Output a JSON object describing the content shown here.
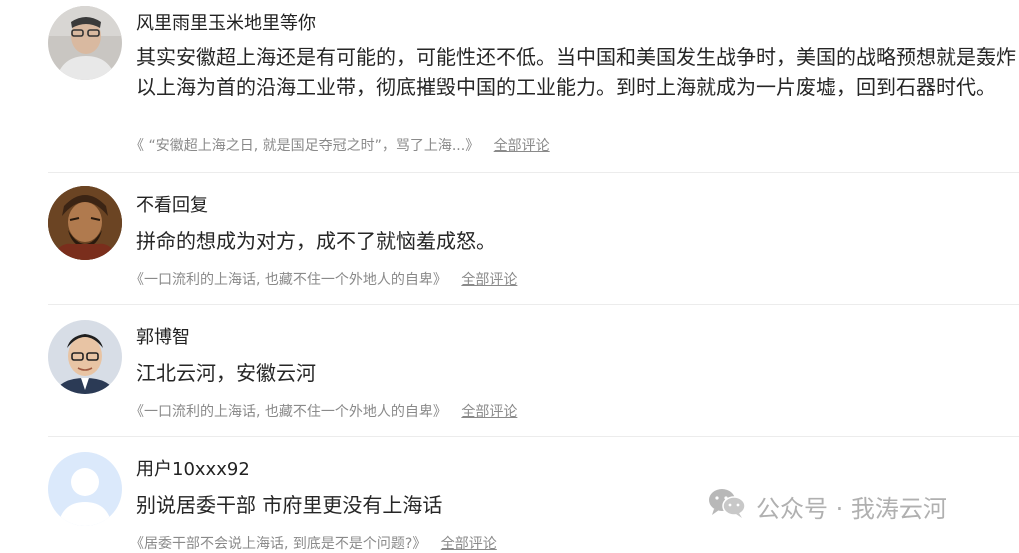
{
  "comments": [
    {
      "username": "风里雨里玉米地里等你",
      "text": "其实安徽超上海还是有可能的，可能性还不低。当中国和美国发生战争时，美国的战略预想就是轰炸以上海为首的沿海工业带，彻底摧毁中国的工业能力。到时上海就成为一片废墟，回到石器时代。",
      "source": "《 “安徽超上海之日, 就是国足夺冠之时”，骂了上海...》",
      "all_comments_label": "全部评论"
    },
    {
      "username": "不看回复",
      "text": "拼命的想成为对方，成不了就恼羞成怒。",
      "source": "《一口流利的上海话, 也藏不住一个外地人的自卑》",
      "all_comments_label": "全部评论"
    },
    {
      "username": "郭博智",
      "text": "江北云河，安徽云河",
      "source": "《一口流利的上海话, 也藏不住一个外地人的自卑》",
      "all_comments_label": "全部评论"
    },
    {
      "username": "用户10xxx92",
      "text": "别说居委干部 市府里更没有上海话",
      "source": "《居委干部不会说上海话, 到底是不是个问题?》",
      "all_comments_label": "全部评论"
    }
  ],
  "watermark": {
    "text": "公众号 · 我涛云河",
    "icon": "wechat-icon",
    "color": "#b0b0b0"
  }
}
